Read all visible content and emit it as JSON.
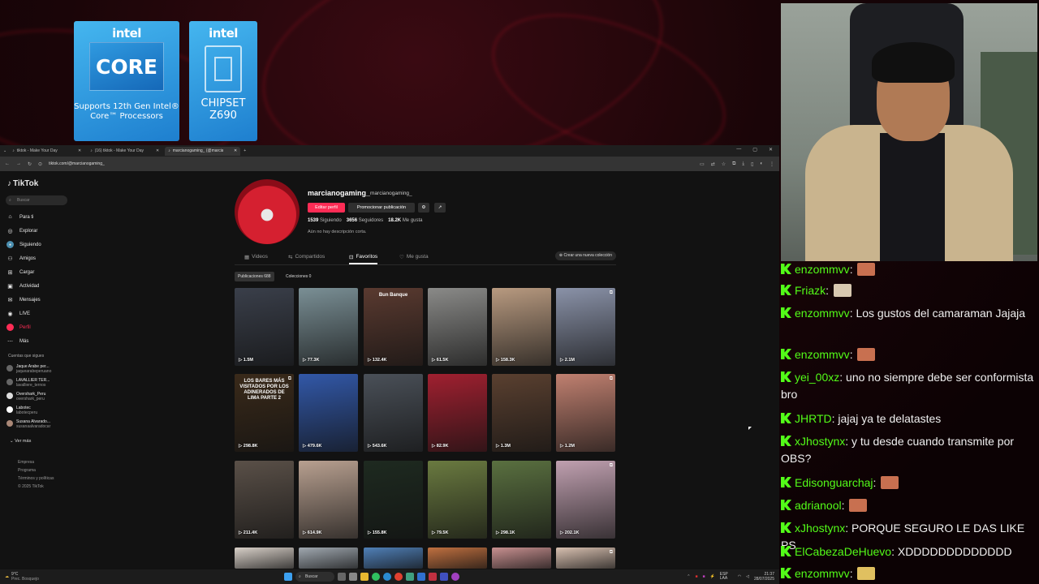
{
  "browser": {
    "tabs": [
      {
        "label": "tiktok - Make Your Day",
        "active": false
      },
      {
        "label": "(16) tiktok - Make Your Day",
        "active": false
      },
      {
        "label": "marcianogaming_ (@marcianogaming_)",
        "active": true
      }
    ],
    "url": "tiktok.com/@marcianogaming_"
  },
  "sidebar": {
    "logo": "TikTok",
    "search_placeholder": "Buscar",
    "nav": [
      {
        "label": "Para ti",
        "icon": "home-icon"
      },
      {
        "label": "Explorar",
        "icon": "compass-icon"
      },
      {
        "label": "Siguiendo",
        "icon": "following-icon"
      },
      {
        "label": "Amigos",
        "icon": "friends-icon"
      },
      {
        "label": "Cargar",
        "icon": "upload-icon"
      },
      {
        "label": "Actividad",
        "icon": "activity-icon"
      },
      {
        "label": "Mensajes",
        "icon": "messages-icon"
      },
      {
        "label": "LIVE",
        "icon": "live-icon"
      },
      {
        "label": "Perfil",
        "icon": "profile-icon"
      },
      {
        "label": "Más",
        "icon": "more-icon"
      }
    ],
    "following_header": "Cuentas que sigues",
    "following": [
      {
        "name": "Jaque Arabe per...",
        "handle": "jaquearabeperuano"
      },
      {
        "name": "LAVALLIER TER...",
        "handle": "lavalliere_ternos"
      },
      {
        "name": "Overshark_Peru",
        "handle": "overshark_peru"
      },
      {
        "name": "Labotec",
        "handle": "labotecperu"
      },
      {
        "name": "Susana Alvarado...",
        "handle": "susanaalvaradocar"
      }
    ],
    "see_more": "Ver más",
    "footer": [
      "Empresa",
      "Programa",
      "Términos y políticas",
      "© 2025 TikTok"
    ]
  },
  "profile": {
    "username": "marcianogaming_",
    "handle": "marcianogaming_",
    "edit_label": "Editar perfil",
    "promo_label": "Promocionar publicación",
    "following_count": "1539",
    "following_label": "Siguiendo",
    "followers_count": "3656",
    "followers_label": "Seguidores",
    "likes_count": "18.2K",
    "likes_label": "Me gusta",
    "bio": "Aún no hay descripción corta.",
    "tabs": [
      "Videos",
      "Compartidos",
      "Favoritos",
      "Me gusta"
    ],
    "new_collection": "Crear una nueva colección",
    "chip_publications": "Publicaciones 688",
    "chip_collections": "Colecciones 0"
  },
  "videos": [
    {
      "views": "1.5M",
      "overlay": "",
      "color": "#3a3f4a"
    },
    {
      "views": "77.3K",
      "overlay": "",
      "color": "#7a8f95"
    },
    {
      "views": "132.4K",
      "overlay": "Bun Banque",
      "color": "#5a3a30"
    },
    {
      "views": "61.5K",
      "overlay": "",
      "color": "#8a8a88"
    },
    {
      "views": "158.3K",
      "overlay": "",
      "color": "#b89a80"
    },
    {
      "views": "2.1M",
      "overlay": "",
      "color": "#8a92a8"
    },
    {
      "views": "298.8K",
      "overlay": "LOS BARES MÁS VISITADOS POR LOS ADINERADOS DE LIMA PARTE 2",
      "color": "#3a2a1a"
    },
    {
      "views": "479.6K",
      "overlay": "",
      "color": "#3258a8"
    },
    {
      "views": "543.6K",
      "overlay": "",
      "color": "#4a5058"
    },
    {
      "views": "82.9K",
      "overlay": "",
      "color": "#a02030"
    },
    {
      "views": "1.3M",
      "overlay": "",
      "color": "#5a4030"
    },
    {
      "views": "1.2M",
      "overlay": "",
      "color": "#c08070"
    },
    {
      "views": "211.4K",
      "overlay": "",
      "color": "#5a5048"
    },
    {
      "views": "614.9K",
      "overlay": "",
      "color": "#b8a090"
    },
    {
      "views": "155.8K",
      "overlay": "",
      "color": "#1e2a20"
    },
    {
      "views": "79.5K",
      "overlay": "",
      "color": "#6a7a40"
    },
    {
      "views": "298.1K",
      "overlay": "",
      "color": "#5a7040"
    },
    {
      "views": "202.1K",
      "overlay": "",
      "color": "#c0a0b0"
    },
    {
      "views": "",
      "overlay": "",
      "color": "#d8d0c8"
    },
    {
      "views": "",
      "overlay": "",
      "color": "#a0a8b0"
    },
    {
      "views": "",
      "overlay": "",
      "color": "#5080b8"
    },
    {
      "views": "",
      "overlay": "",
      "color": "#c07040"
    },
    {
      "views": "",
      "overlay": "",
      "color": "#c89090"
    },
    {
      "views": "",
      "overlay": "",
      "color": "#d8c0b0"
    }
  ],
  "stickers": {
    "core_brand": "intel",
    "core_text": "CORE",
    "core_caption": "Supports 12th Gen Intel® Core™ Processors",
    "chip_brand": "intel",
    "chip_text_1": "CHIPSET",
    "chip_text_2": "Z690"
  },
  "taskbar": {
    "temp": "9°C",
    "weather": "Prec. Bosquejo",
    "search": "Buscar",
    "lang": "ESP LAA",
    "time": "21:37",
    "date": "28/07/2025"
  },
  "chat": [
    {
      "user": "enzommvv",
      "text": "",
      "emote": "#c87050"
    },
    {
      "user": "Friazk",
      "text": "",
      "emote": "#d8c8b0"
    },
    {
      "user": "enzommvv",
      "text": "Los gustos del camaraman Jajaja",
      "emote": ""
    },
    {
      "user": "enzommvv",
      "text": "",
      "emote": "#c87050"
    },
    {
      "user": "yei_00xz",
      "text": "uno no siempre debe ser conformista bro",
      "emote": ""
    },
    {
      "user": "JHRTD",
      "text": "jajaj ya te delatastes",
      "emote": ""
    },
    {
      "user": "xJhostynx",
      "text": "y tu desde cuando transmite por OBS?",
      "emote": ""
    },
    {
      "user": "Edisonguarchaj",
      "text": "",
      "emote": "#c87050"
    },
    {
      "user": "adrianool",
      "text": "",
      "emote": "#c87050"
    },
    {
      "user": "xJhostynx",
      "text": "PORQUE SEGURO LE DAS LIKE PS",
      "emote": ""
    },
    {
      "user": "ElCabezaDeHuevo",
      "text": "XDDDDDDDDDDDDD",
      "emote": ""
    },
    {
      "user": "enzommvv",
      "text": "",
      "emote": "#e0c060"
    }
  ],
  "colors": {
    "tiktok_red": "#fe2c55",
    "kick_green": "#53fc18"
  }
}
